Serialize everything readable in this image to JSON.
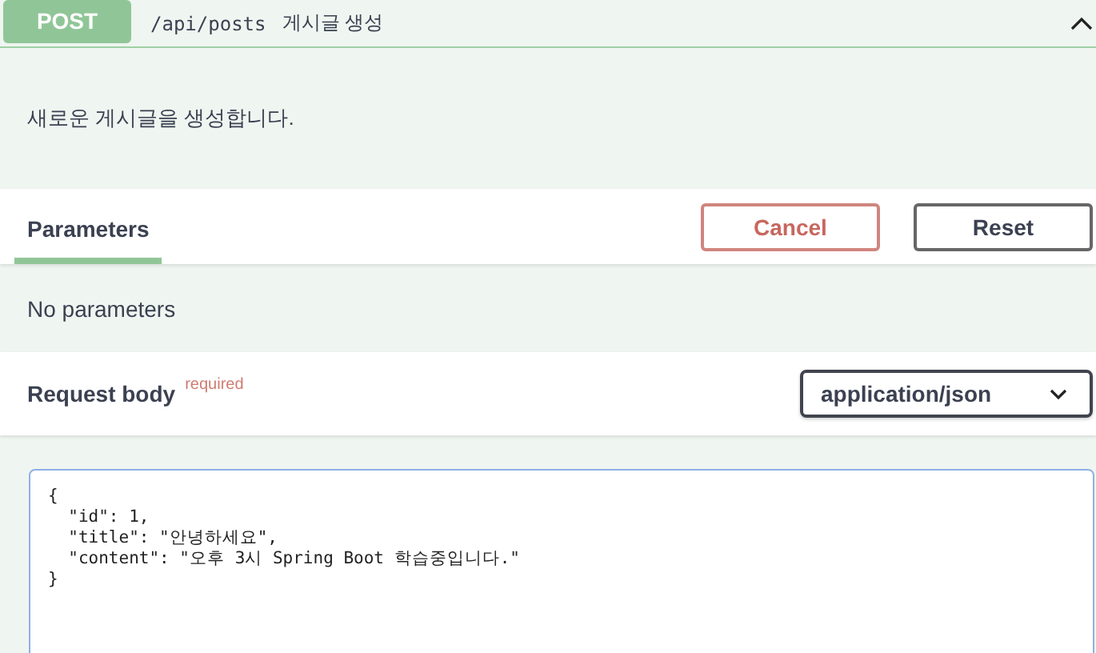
{
  "operation": {
    "method": "POST",
    "path": "/api/posts",
    "summary": "게시글 생성",
    "expanded": true
  },
  "description": "새로운 게시글을 생성합니다.",
  "tabs": [
    {
      "label": "Parameters",
      "selected": true
    }
  ],
  "buttons": [
    {
      "label": "Cancel",
      "kind": "cancel"
    },
    {
      "label": "Reset",
      "kind": "reset"
    }
  ],
  "parameters_message": "No parameters",
  "request_body": {
    "title": "Request body",
    "required_label": "required",
    "content_type": "application/json",
    "lines": [
      "{",
      "  \"id\": 1,",
      "  \"title\": \"안녕하세요\",",
      "  \"content\": \"오후 3시 Spring Boot 학습중입니다.\"",
      "}"
    ]
  }
}
